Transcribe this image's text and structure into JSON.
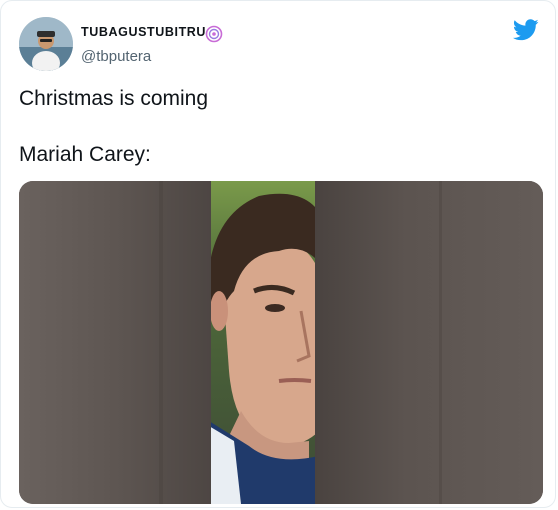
{
  "tweet": {
    "display_name": "TUBAGUSTUBITRU",
    "handle": "@tbputera",
    "text_line1": "Christmas is coming",
    "text_line2": "Mariah Carey:"
  },
  "icons": {
    "badge": "swirl-badge-icon",
    "brand": "twitter-bird-icon"
  },
  "colors": {
    "twitter_blue": "#1d9bf0",
    "handle_gray": "#536471",
    "badge_pink": "#c86bd6"
  }
}
